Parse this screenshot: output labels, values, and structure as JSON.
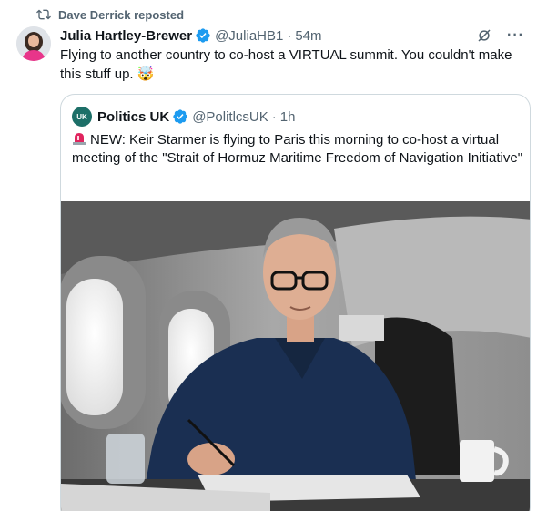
{
  "repost": {
    "text": "Dave Derrick reposted",
    "icon": "repost-icon"
  },
  "tweet": {
    "author_name": "Julia Hartley-Brewer",
    "handle": "@JuliaHB1",
    "separator": "·",
    "time": "54m",
    "text": "Flying to another country to co-host a VIRTUAL summit. You couldn't make this stuff up. 🤯",
    "more_label": "···"
  },
  "quote": {
    "avatar_text": "UK",
    "author_name": "Politics UK",
    "handle": "@PolitlcsUK",
    "separator": "·",
    "time": "1h",
    "text": "NEW: Keir Starmer is flying to Paris this morning to co-host a virtual meeting of the \"Strait of Hormuz Maritime Freedom of Navigation Initiative\""
  },
  "colors": {
    "verified": "#1d9bf0",
    "muted": "#536471",
    "border": "#cfd9de",
    "siren": "#e0245e"
  }
}
